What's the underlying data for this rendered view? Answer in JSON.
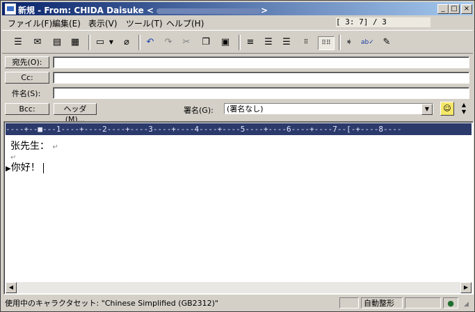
{
  "window": {
    "title": "新規 - From: CHIDA Daisuke",
    "controls": [
      "_",
      "□",
      "×"
    ]
  },
  "menu": [
    {
      "label": "ファイル(F)"
    },
    {
      "label": "編集(E)"
    },
    {
      "label": "表示(V)"
    },
    {
      "label": "ツール(T)"
    },
    {
      "label": "ヘルプ(H)"
    }
  ],
  "counter": "[    3:  7] / 3",
  "toolbar_icons": [
    "address-book-icon",
    "send-icon",
    "attach-note-icon",
    "calendar-icon",
    "format-icon",
    "dropdown-icon",
    "paperclip-icon",
    "undo-icon",
    "redo-icon",
    "cut-icon",
    "copy-icon",
    "paste-icon",
    "align-center-icon",
    "align-left-icon",
    "align-right-icon",
    "grid-icon",
    "dotted-grid-icon",
    "forward-icon",
    "spellcheck-icon",
    "compose-icon"
  ],
  "header": {
    "to_label": "宛先(O):",
    "cc_label": "Cc:",
    "subject_label": "件名(S):",
    "bcc_label": "Bcc:",
    "header_button": "ヘッダ(M)...",
    "signature_label": "署名(G):",
    "signature_value": "(署名なし)"
  },
  "editor": {
    "ruler": "----+--■---1----+----2----+----3----+----4----+----5----+----6----+----7--[-+----8----",
    "lines": [
      "张先生：",
      "",
      "你好！"
    ]
  },
  "status": {
    "charset": "使用中のキャラクタセット: \"Chinese Simplified (GB2312)\"",
    "mode": "自動整形"
  }
}
